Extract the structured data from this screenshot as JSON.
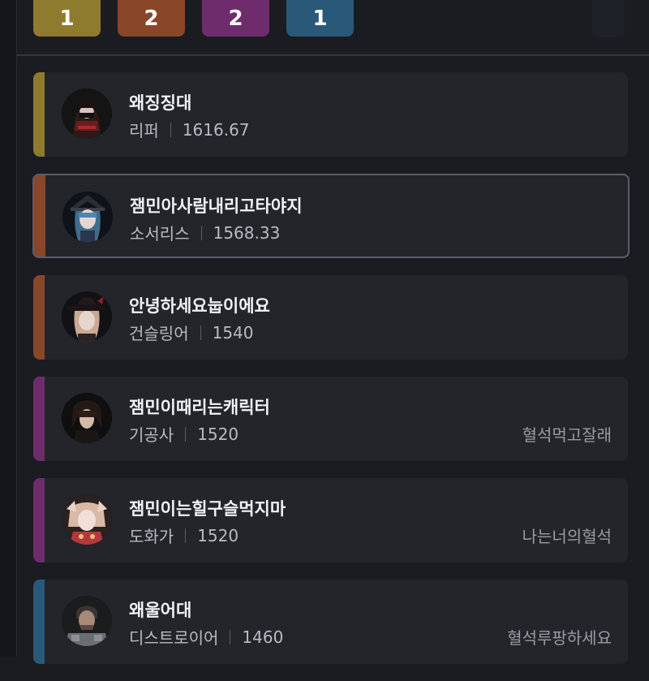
{
  "class_counts": [
    {
      "value": "1",
      "color": "#8f7b2e"
    },
    {
      "value": "2",
      "color": "#8a4628"
    },
    {
      "value": "2",
      "color": "#6f2c6c"
    },
    {
      "value": "1",
      "color": "#2a5878"
    }
  ],
  "members": [
    {
      "name": "왜징징대",
      "job": "리퍼",
      "score": "1616.67",
      "guild": "",
      "accent": "#8f7b2e",
      "avatar": "reaper-portrait",
      "selected": false
    },
    {
      "name": "잼민아사람내리고타야지",
      "job": "소서리스",
      "score": "1568.33",
      "guild": "",
      "accent": "#8a4628",
      "avatar": "sorceress-portrait",
      "selected": true
    },
    {
      "name": "안녕하세요눕이에요",
      "job": "건슬링어",
      "score": "1540",
      "guild": "",
      "accent": "#8a4628",
      "avatar": "gunslinger-portrait",
      "selected": false
    },
    {
      "name": "잼민이때리는캐릭터",
      "job": "기공사",
      "score": "1520",
      "guild": "혈석먹고잘래",
      "accent": "#6f2c6c",
      "avatar": "soulfist-portrait",
      "selected": false
    },
    {
      "name": "잼민이는힐구슬먹지마",
      "job": "도화가",
      "score": "1520",
      "guild": "나는너의혈석",
      "accent": "#6f2c6c",
      "avatar": "artist-portrait",
      "selected": false
    },
    {
      "name": "왜울어대",
      "job": "디스트로이어",
      "score": "1460",
      "guild": "혈석루팡하세요",
      "accent": "#2a5878",
      "avatar": "destroyer-portrait",
      "selected": false
    }
  ]
}
